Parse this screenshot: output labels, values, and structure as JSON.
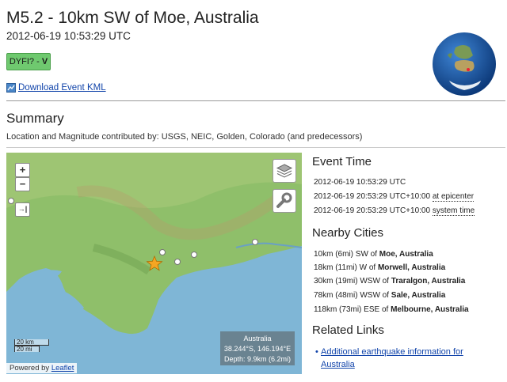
{
  "header": {
    "title": "M5.2 - 10km SW of Moe, Australia",
    "datetime": "2012-06-19 10:53:29 UTC",
    "dyfi_label": "DYFI? -",
    "dyfi_value": "V",
    "dyfi_color": "#6fc96f",
    "kml_link": "Download Event KML"
  },
  "summary": {
    "heading": "Summary",
    "contributors": "Location and Magnitude contributed by: USGS, NEIC, Golden, Colorado (and predecessors)"
  },
  "map": {
    "zoom_in": "+",
    "zoom_out": "−",
    "scale_km": "20 km",
    "scale_mi": "20 mi",
    "powered_by": "Powered by",
    "leaflet_link": "Leaflet",
    "info_region": "Australia",
    "info_coords": "38.244°S, 146.194°E",
    "info_depth": "Depth: 9.9km (6.2mi)",
    "epicenter_color": "#f5a623",
    "water_color": "#7fb6d6",
    "land_color": "#8fbf6a"
  },
  "event_time": {
    "heading": "Event Time",
    "utc": "2012-06-19 10:53:29 UTC",
    "epicenter_time": "2012-06-19 20:53:29 UTC+10:00",
    "epicenter_label": "at epicenter",
    "system_time": "2012-06-19 20:53:29 UTC+10:00",
    "system_label": "system time"
  },
  "nearby": {
    "heading": "Nearby Cities",
    "cities": [
      {
        "prefix": "10km (6mi) SW of",
        "name": "Moe, Australia"
      },
      {
        "prefix": "18km (11mi) W of",
        "name": "Morwell, Australia"
      },
      {
        "prefix": "30km (19mi) WSW of",
        "name": "Traralgon, Australia"
      },
      {
        "prefix": "78km (48mi) WSW of",
        "name": "Sale, Australia"
      },
      {
        "prefix": "118km (73mi) ESE of",
        "name": "Melbourne, Australia"
      }
    ]
  },
  "related": {
    "heading": "Related Links",
    "link": "Additional earthquake information for Australia"
  }
}
